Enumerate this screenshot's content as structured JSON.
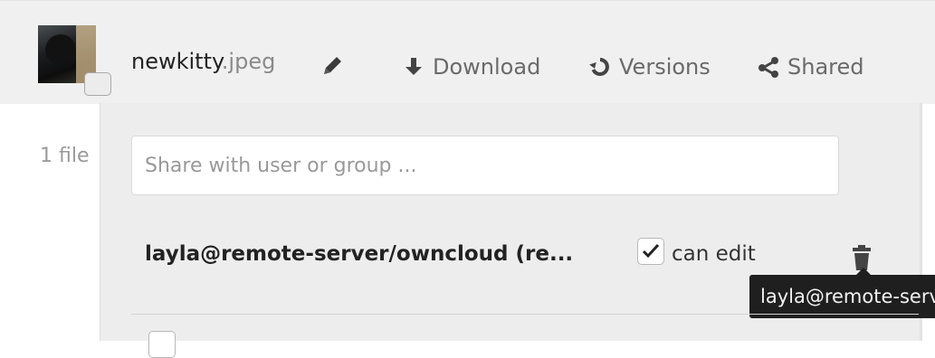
{
  "file": {
    "name_base": "newkitty",
    "name_ext": ".jpeg"
  },
  "actions": {
    "download_label": "Download",
    "versions_label": "Versions",
    "shared_label": "Shared"
  },
  "file_list": {
    "count_text": "1 file"
  },
  "share": {
    "input_placeholder": "Share with user or group ...",
    "input_value": "",
    "recipients": [
      {
        "display_name": "layla@remote-server/owncloud (re...",
        "can_edit": true,
        "permission_label": "can edit",
        "tooltip": "layla@remote-server/owncloud"
      }
    ]
  },
  "icons": {
    "rename": "pencil-icon",
    "download": "download-icon",
    "versions": "history-icon",
    "shared": "share-icon",
    "delete": "trash-icon",
    "check": "checkmark-icon"
  },
  "colors": {
    "panel_background": "#ededed",
    "file_row_background": "#f0f0f0",
    "tooltip_background": "#1f1f1f"
  }
}
